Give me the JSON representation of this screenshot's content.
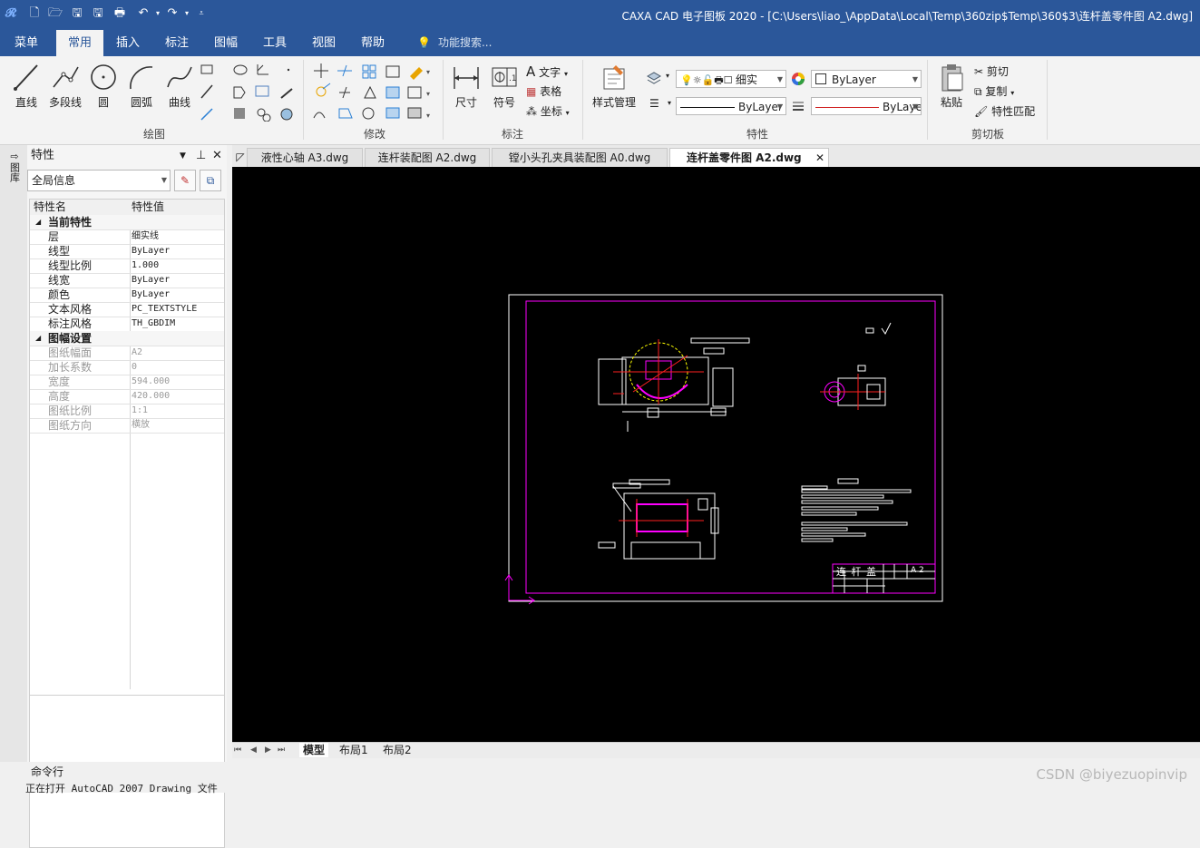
{
  "window": {
    "title": "CAXA CAD 电子图板 2020 - [C:\\Users\\liao_\\AppData\\Local\\Temp\\360zip$Temp\\360$3\\连杆盖零件图 A2.dwg]"
  },
  "menu": {
    "tabs": [
      "菜单",
      "常用",
      "插入",
      "标注",
      "图幅",
      "工具",
      "视图",
      "帮助"
    ],
    "active": "常用",
    "search_placeholder": "功能搜索..."
  },
  "ribbon": {
    "draw": {
      "label": "绘图",
      "line": "直线",
      "polyline": "多段线",
      "circle": "圆",
      "arc": "圆弧",
      "curve": "曲线"
    },
    "modify": {
      "label": "修改"
    },
    "annotate": {
      "label": "标注",
      "dimension": "尺寸",
      "symbol": "符号",
      "text": "文字",
      "table": "表格",
      "coord": "坐标"
    },
    "style": {
      "label": "样式管理"
    },
    "properties": {
      "label": "特性",
      "layer_value": "细实",
      "color_value": "ByLayer",
      "linetype_value": "ByLayer",
      "lineweight_value": "ByLaye"
    },
    "clipboard": {
      "label": "剪切板",
      "paste": "粘贴",
      "cut": "剪切",
      "copy": "复制",
      "match": "特性匹配"
    }
  },
  "panel": {
    "title": "特性",
    "side_label": "图库",
    "selector": "全局信息",
    "col_name": "特性名",
    "col_value": "特性值",
    "cat_current": "当前特性",
    "cat_sheet": "图幅设置",
    "rows_current": [
      {
        "k": "层",
        "v": "细实线"
      },
      {
        "k": "线型",
        "v": "ByLayer"
      },
      {
        "k": "线型比例",
        "v": "1.000"
      },
      {
        "k": "线宽",
        "v": "ByLayer"
      },
      {
        "k": "颜色",
        "v": "ByLayer"
      },
      {
        "k": "文本风格",
        "v": "PC_TEXTSTYLE"
      },
      {
        "k": "标注风格",
        "v": "TH_GBDIM"
      }
    ],
    "rows_sheet": [
      {
        "k": "图纸幅面",
        "v": "A2"
      },
      {
        "k": "加长系数",
        "v": "0"
      },
      {
        "k": "宽度",
        "v": "594.000"
      },
      {
        "k": "高度",
        "v": "420.000"
      },
      {
        "k": "图纸比例",
        "v": "1:1"
      },
      {
        "k": "图纸方向",
        "v": "横放"
      }
    ]
  },
  "doc_tabs": [
    "液性心轴 A3.dwg",
    "连杆装配图 A2.dwg",
    "镗小头孔夹具装配图 A0.dwg",
    "连杆盖零件图 A2.dwg"
  ],
  "drawing": {
    "title_block_name": "连 杆 盖",
    "title_block_size": "A 2"
  },
  "layout_tabs": [
    "模型",
    "布局1",
    "布局2"
  ],
  "command": {
    "label": "命令行",
    "output": "正在打开 AutoCAD 2007 Drawing 文件"
  },
  "watermark": "CSDN @biyezuopinvip",
  "colors": {
    "brand": "#2b579a",
    "magenta": "#ff00ff",
    "red": "#ff2020",
    "yellow": "#ffff00"
  }
}
